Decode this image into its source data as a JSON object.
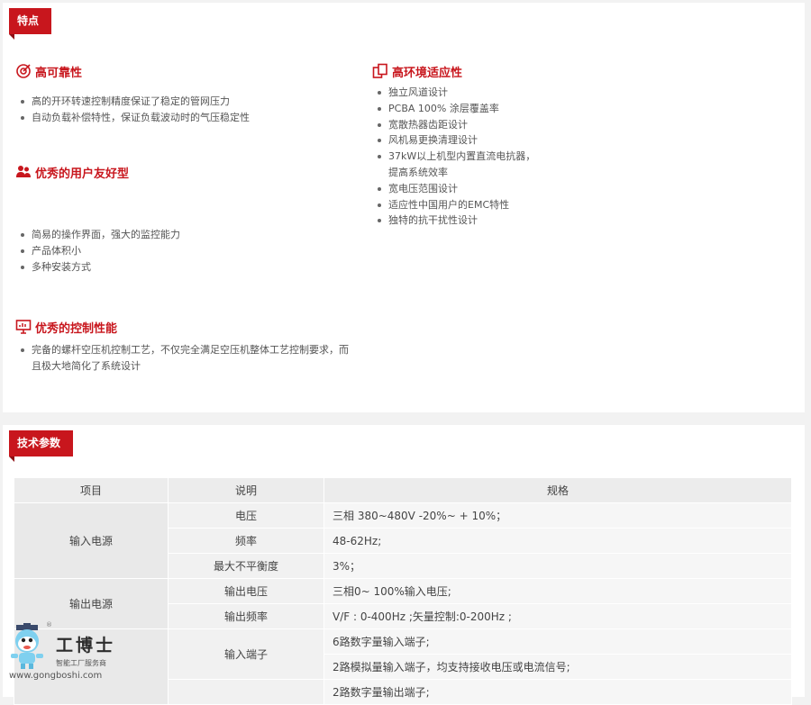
{
  "features": {
    "tag": "特点",
    "reliability": {
      "title": "高可靠性",
      "icon": "target-icon",
      "items": [
        "高的开环转速控制精度保证了稳定的管网压力",
        "自动负载补偿特性，保证负载波动时的气压稳定性"
      ]
    },
    "adaptability": {
      "title": "高环境适应性",
      "icon": "copy-icon",
      "items": [
        "独立风道设计",
        "PCBA 100% 涂层覆盖率",
        "宽散热器齿距设计",
        "风机易更换清理设计",
        "37kW以上机型内置直流电抗器，",
        "提高系统效率",
        "宽电压范围设计",
        "适应性中国用户的EMC特性",
        "独特的抗干扰性设计"
      ]
    },
    "usability": {
      "title": "优秀的用户友好型",
      "icon": "users-icon",
      "items": [
        "简易的操作界面，强大的监控能力",
        "产品体积小",
        "多种安装方式"
      ]
    },
    "control": {
      "title": "优秀的控制性能",
      "icon": "monitor-icon",
      "items": [
        "完备的螺杆空压机控制工艺，不仅完全满足空压机整体工艺控制要求，而且极大地简化了系统设计"
      ]
    }
  },
  "specs": {
    "tag": "技术参数",
    "headers": [
      "项目",
      "说明",
      "规格"
    ],
    "groups": {
      "input_power": "输入电源",
      "output_power": "输出电源"
    },
    "rows": {
      "voltage": {
        "name": "电压",
        "value": "三相 380~480V -20%~ + 10%；"
      },
      "frequency": {
        "name": "频率",
        "value": "48-62Hz;"
      },
      "imbalance": {
        "name": "最大不平衡度",
        "value": "3%；"
      },
      "out_voltage": {
        "name": "输出电压",
        "value": "三相0~ 100%输入电压;"
      },
      "out_frequency": {
        "name": "输出频率",
        "value": "V/F : 0-400Hz ;矢量控制:0-200Hz ;"
      },
      "input_terminal": {
        "name": "输入端子",
        "value1": "6路数字量输入端子;",
        "value2": "2路模拟量输入端子，均支持接收电压或电流信号;"
      },
      "output_terminal": {
        "value1": "2路数字量输出端子;"
      }
    }
  },
  "watermark": {
    "name": "工博士",
    "subtitle": "智能工厂服务商",
    "url": "www.gongboshi.com",
    "registered": "®"
  },
  "colors": {
    "accent": "#c8161d",
    "background": "#f2f2f2"
  }
}
